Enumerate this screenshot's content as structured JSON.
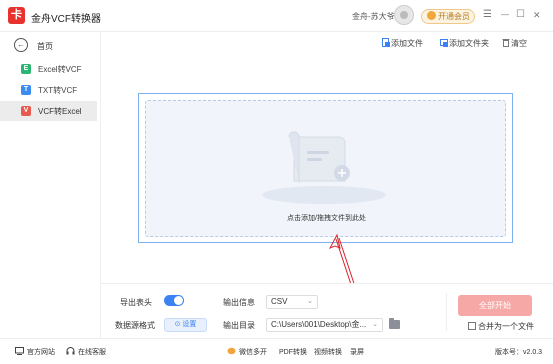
{
  "app": {
    "logo_glyph": "卡",
    "title": "金舟VCF转换器",
    "user_name": "金舟-苏大爷",
    "vip_label": "开通会员",
    "menu_glyph": "☰",
    "minimize_glyph": "—",
    "maximize_glyph": "☐",
    "close_glyph": "✕"
  },
  "sidebar": {
    "home_label": "首页",
    "items": [
      {
        "icon_letter": "E",
        "label": "Excel转VCF",
        "color": "#2bb673",
        "active": false
      },
      {
        "icon_letter": "T",
        "label": "TXT转VCF",
        "color": "#3c8cf0",
        "active": false
      },
      {
        "icon_letter": "V",
        "label": "VCF转Excel",
        "color": "#e85a4f",
        "active": true
      }
    ]
  },
  "toolbar": {
    "add_file": "添加文件",
    "add_folder": "添加文件夹",
    "clear": "清空"
  },
  "dropzone": {
    "hint": "点击添加/拖拽文件到此处"
  },
  "options": {
    "export_header_label": "导出表头",
    "export_header_on": true,
    "datasource_label": "数据源格式",
    "settings_button": "设置",
    "output_info_label": "输出信息",
    "output_format": "CSV",
    "output_dir_label": "输出目录",
    "output_dir": "C:\\Users\\001\\Desktop\\金..."
  },
  "actions": {
    "start_label": "全部开始",
    "merge_label": "合并为一个文件",
    "merge_checked": false
  },
  "statusbar": {
    "website": "官方网站",
    "support": "在线客服",
    "multi_open": "微信多开",
    "pdf": "PDF转换",
    "video": "视频转换",
    "record": "录屏",
    "version": "版本号：v2.0.3"
  },
  "colors": {
    "accent": "#3c82f2",
    "start_button": "#f6a8a6",
    "dropzone_border": "#7fb0ee",
    "annotation_arrow": "#d9242b"
  }
}
